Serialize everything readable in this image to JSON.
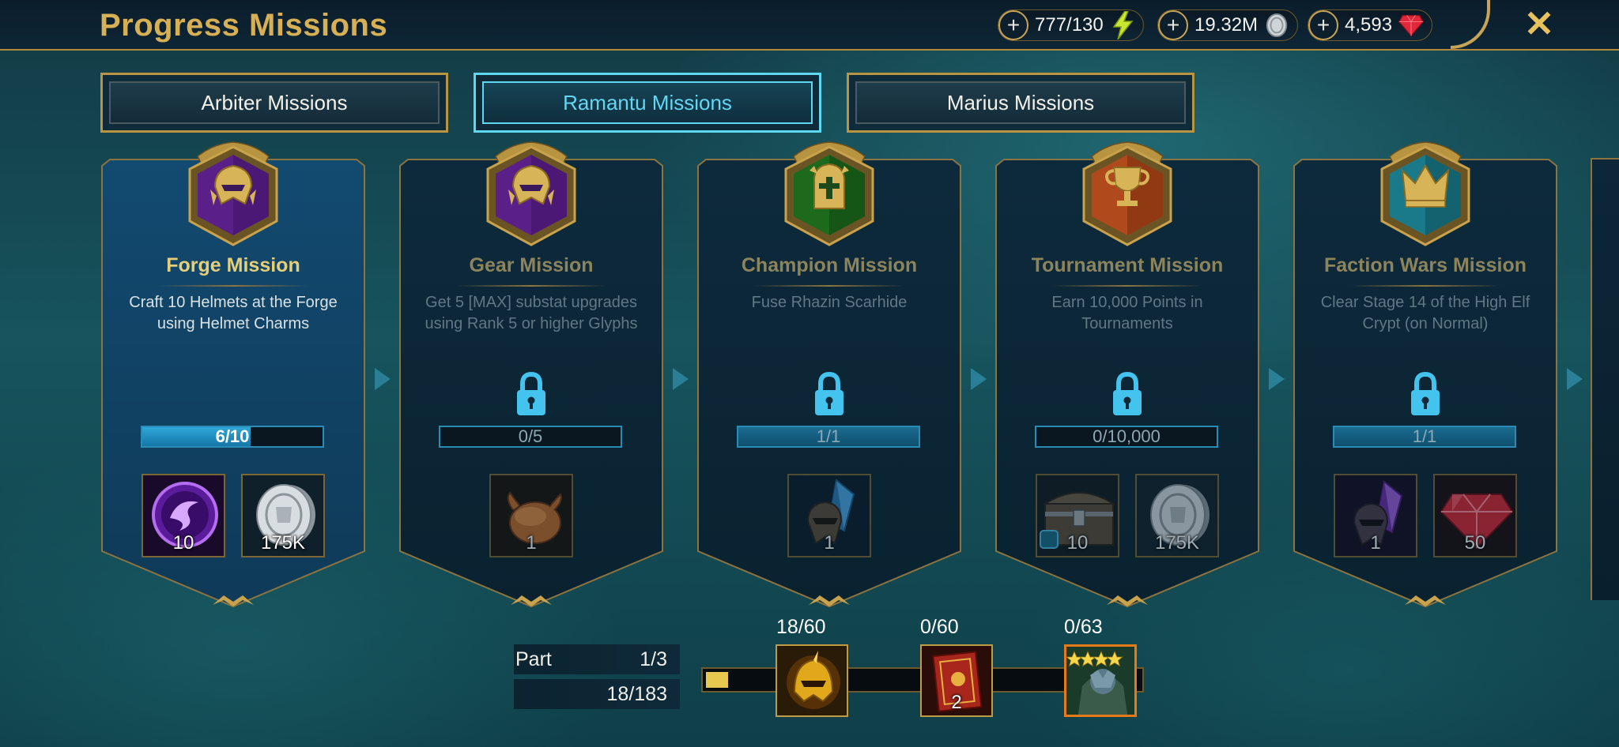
{
  "header": {
    "title": "Progress Missions",
    "energy": "777/130",
    "silver": "19.32M",
    "gems": "4,593"
  },
  "tabs": [
    {
      "label": "Arbiter Missions",
      "active": false
    },
    {
      "label": "Ramantu Missions",
      "active": true
    },
    {
      "label": "Marius Missions",
      "active": false
    }
  ],
  "missions": [
    {
      "title": "Forge Mission",
      "desc": "Craft 10 Helmets at the Forge using Helmet Charms",
      "progress": "6/10",
      "fill": 0.6,
      "locked": false,
      "rewards": [
        {
          "icon": "purple-orb-icon",
          "count": "10"
        },
        {
          "icon": "silver-coin-icon",
          "count": "175K"
        }
      ]
    },
    {
      "title": "Gear Mission",
      "desc": "Get 5 [MAX] substat upgrades using Rank 5 or higher Glyphs",
      "progress": "0/5",
      "fill": 0,
      "locked": true,
      "rewards": [
        {
          "icon": "roast-chicken-icon",
          "count": "1"
        }
      ]
    },
    {
      "title": "Champion Mission",
      "desc": "Fuse Rhazin Scarhide",
      "progress": "1/1",
      "fill": 1,
      "locked": true,
      "rewards": [
        {
          "icon": "blue-shard-icon",
          "count": "1"
        }
      ]
    },
    {
      "title": "Tournament Mission",
      "desc": "Earn 10,000 Points in Tournaments",
      "progress": "0/10,000",
      "fill": 0,
      "locked": true,
      "rewards": [
        {
          "icon": "chest-icon",
          "count": "10"
        },
        {
          "icon": "silver-coin-icon",
          "count": "175K"
        }
      ]
    },
    {
      "title": "Faction Wars Mission",
      "desc": "Clear Stage 14 of the High Elf Crypt (on Normal)",
      "progress": "1/1",
      "fill": 1,
      "locked": true,
      "rewards": [
        {
          "icon": "void-shard-icon",
          "count": "1"
        },
        {
          "icon": "gem-icon",
          "count": "50"
        }
      ]
    }
  ],
  "part": {
    "label": "Part",
    "value": "1/3",
    "total": "18/183",
    "fill": 0.05
  },
  "milestones": [
    {
      "label": "18/60",
      "icon": "golden-helmet-icon",
      "count": ""
    },
    {
      "label": "0/60",
      "icon": "red-tome-icon",
      "count": "2"
    },
    {
      "label": "0/63",
      "icon": "champion-portrait-icon",
      "count": ""
    }
  ],
  "colors": {
    "gold": "#d7b056",
    "cyan": "#5ed7f0",
    "card": "#0d2a3c",
    "cardActive": "#124a70"
  }
}
